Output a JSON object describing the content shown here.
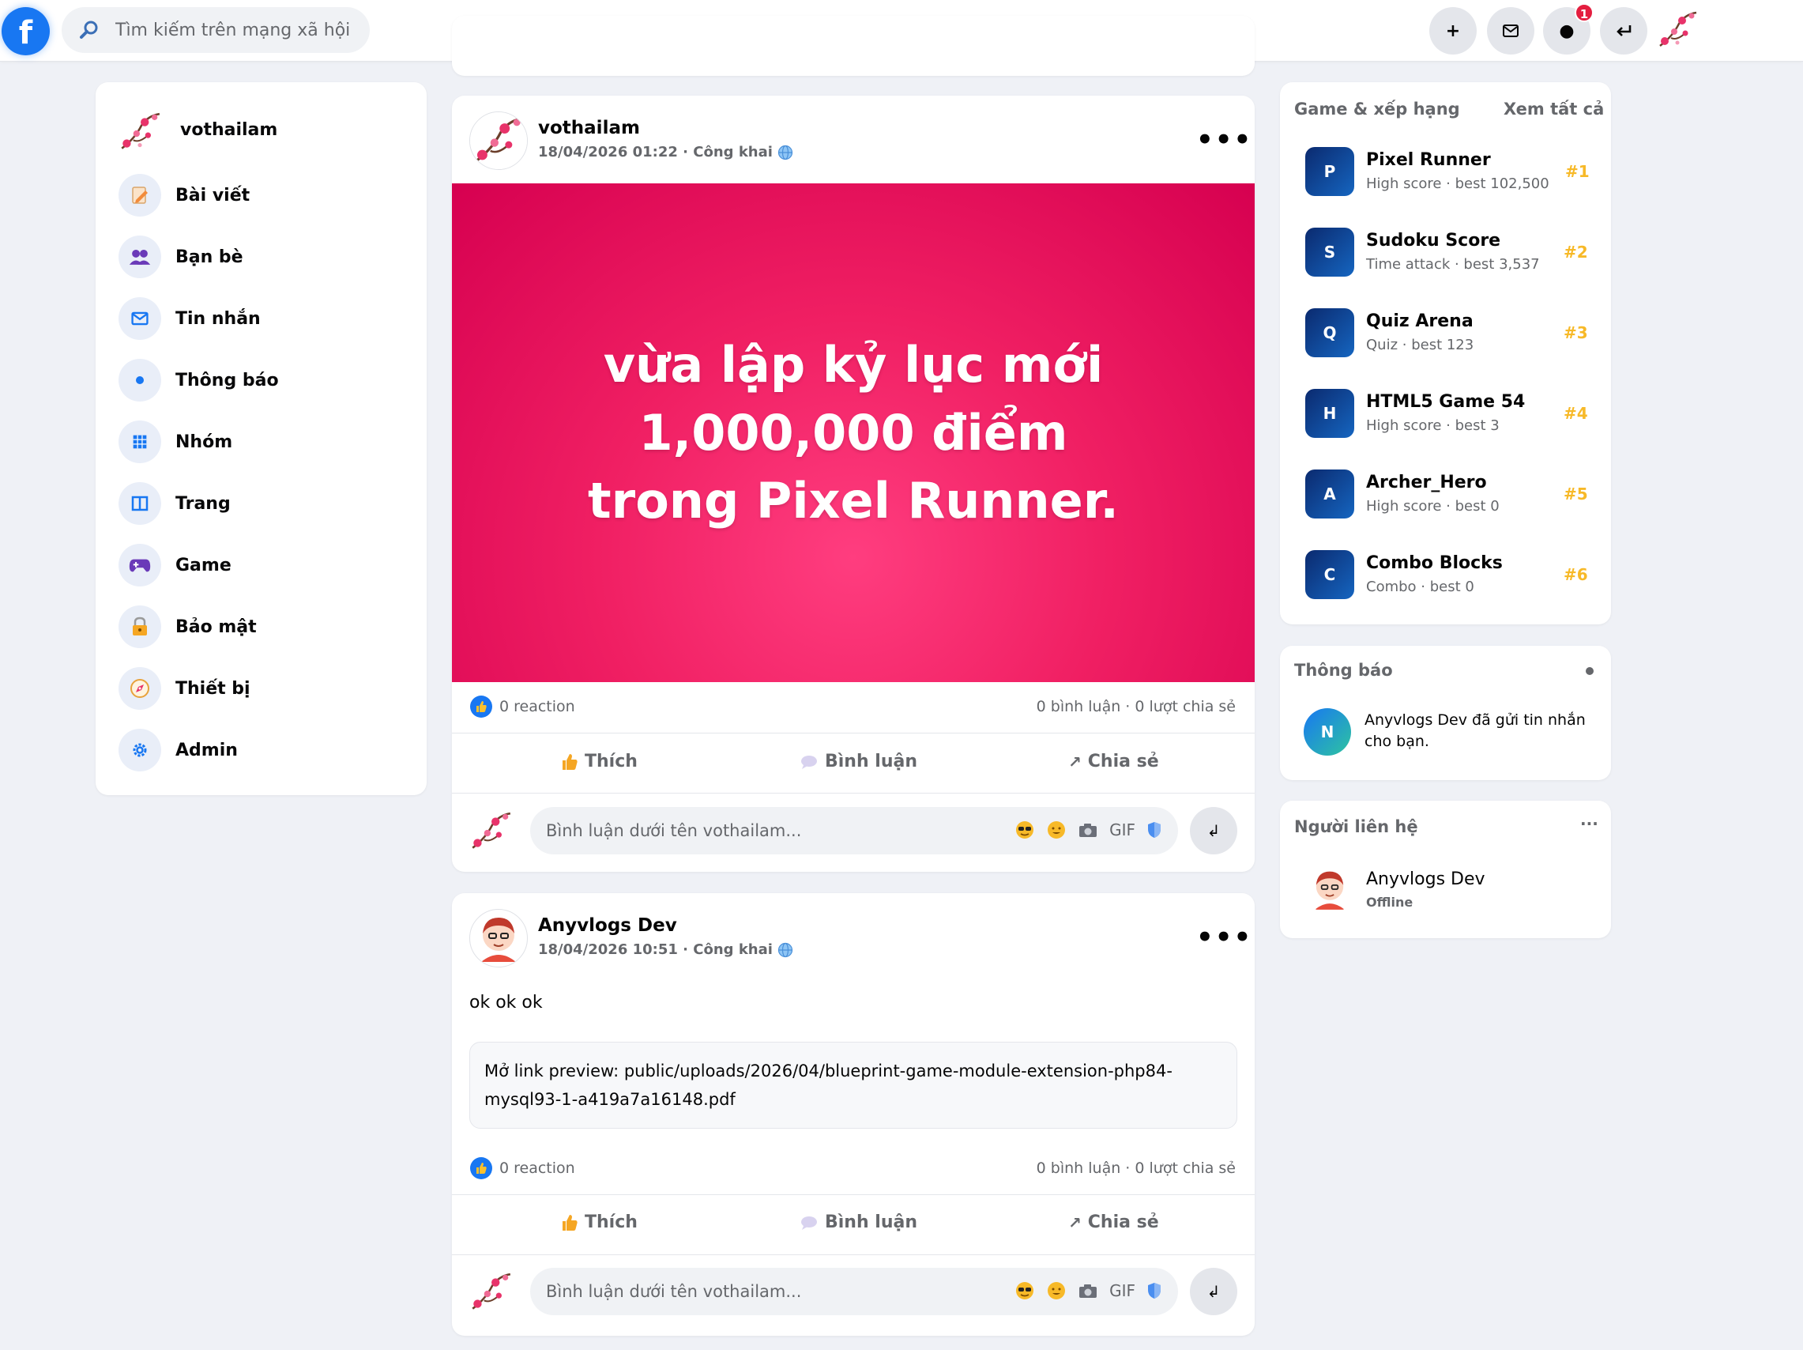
{
  "topbar": {
    "search_placeholder": "Tìm kiếm trên mạng xã hội",
    "notif_count": "1",
    "logo_letter": "f"
  },
  "left_menu": {
    "profile_name": "vothailam",
    "items": [
      {
        "label": "Bài viết",
        "icon": "edit-icon"
      },
      {
        "label": "Bạn bè",
        "icon": "friends-icon"
      },
      {
        "label": "Tin nhắn",
        "icon": "mail-icon"
      },
      {
        "label": "Thông báo",
        "icon": "dot-icon"
      },
      {
        "label": "Nhóm",
        "icon": "grid-icon"
      },
      {
        "label": "Trang",
        "icon": "page-icon"
      },
      {
        "label": "Game",
        "icon": "gamepad-icon"
      },
      {
        "label": "Bảo mật",
        "icon": "lock-icon"
      },
      {
        "label": "Thiết bị",
        "icon": "compass-icon"
      },
      {
        "label": "Admin",
        "icon": "gear-icon"
      }
    ]
  },
  "posts": [
    {
      "author": "vothailam",
      "date": "18/04/2026 01:22 · Công khai",
      "banner_lines": [
        "vừa lập kỷ lục mới",
        "1,000,000 điểm",
        "trong Pixel Runner."
      ],
      "reactions": "0 reaction",
      "stats": "0 bình luận · 0 lượt chia sẻ",
      "like_label": "Thích",
      "comment_label": "Bình luận",
      "share_label": "Chia sẻ",
      "comment_placeholder": "Bình luận dưới tên vothailam...",
      "gif_label": "GIF"
    },
    {
      "author": "Anyvlogs Dev",
      "date": "18/04/2026 10:51 · Công khai",
      "text": "ok ok ok",
      "link_preview": "Mở link preview: public/uploads/2026/04/blueprint-game-module-extension-php84-mysql93-1-a419a7a16148.pdf",
      "reactions": "0 reaction",
      "stats": "0 bình luận · 0 lượt chia sẻ",
      "like_label": "Thích",
      "comment_label": "Bình luận",
      "share_label": "Chia sẻ",
      "comment_placeholder": "Bình luận dưới tên vothailam...",
      "gif_label": "GIF"
    }
  ],
  "games": {
    "title": "Game & xếp hạng",
    "see_all": "Xem tất cả",
    "items": [
      {
        "letter": "P",
        "name": "Pixel Runner",
        "sub": "High score · best 102,500",
        "rank": "#1"
      },
      {
        "letter": "S",
        "name": "Sudoku Score",
        "sub": "Time attack · best 3,537",
        "rank": "#2"
      },
      {
        "letter": "Q",
        "name": "Quiz Arena",
        "sub": "Quiz · best 123",
        "rank": "#3"
      },
      {
        "letter": "H",
        "name": "HTML5 Game 54",
        "sub": "High score · best 3",
        "rank": "#4"
      },
      {
        "letter": "A",
        "name": "Archer_Hero",
        "sub": "High score · best 0",
        "rank": "#5"
      },
      {
        "letter": "C",
        "name": "Combo Blocks",
        "sub": "Combo · best 0",
        "rank": "#6"
      }
    ]
  },
  "notifications": {
    "title": "Thông báo",
    "item_letter": "N",
    "item_text": "Anyvlogs Dev đã gửi tin nhắn cho bạn."
  },
  "contacts": {
    "title": "Người liên hệ",
    "more": "···",
    "name": "Anyvlogs Dev",
    "status": "Offline"
  },
  "colors": {
    "brand": "#1877f2",
    "banner_from": "#e8125c",
    "banner_to": "#d4004d",
    "rank_gold": "#f7b928"
  }
}
